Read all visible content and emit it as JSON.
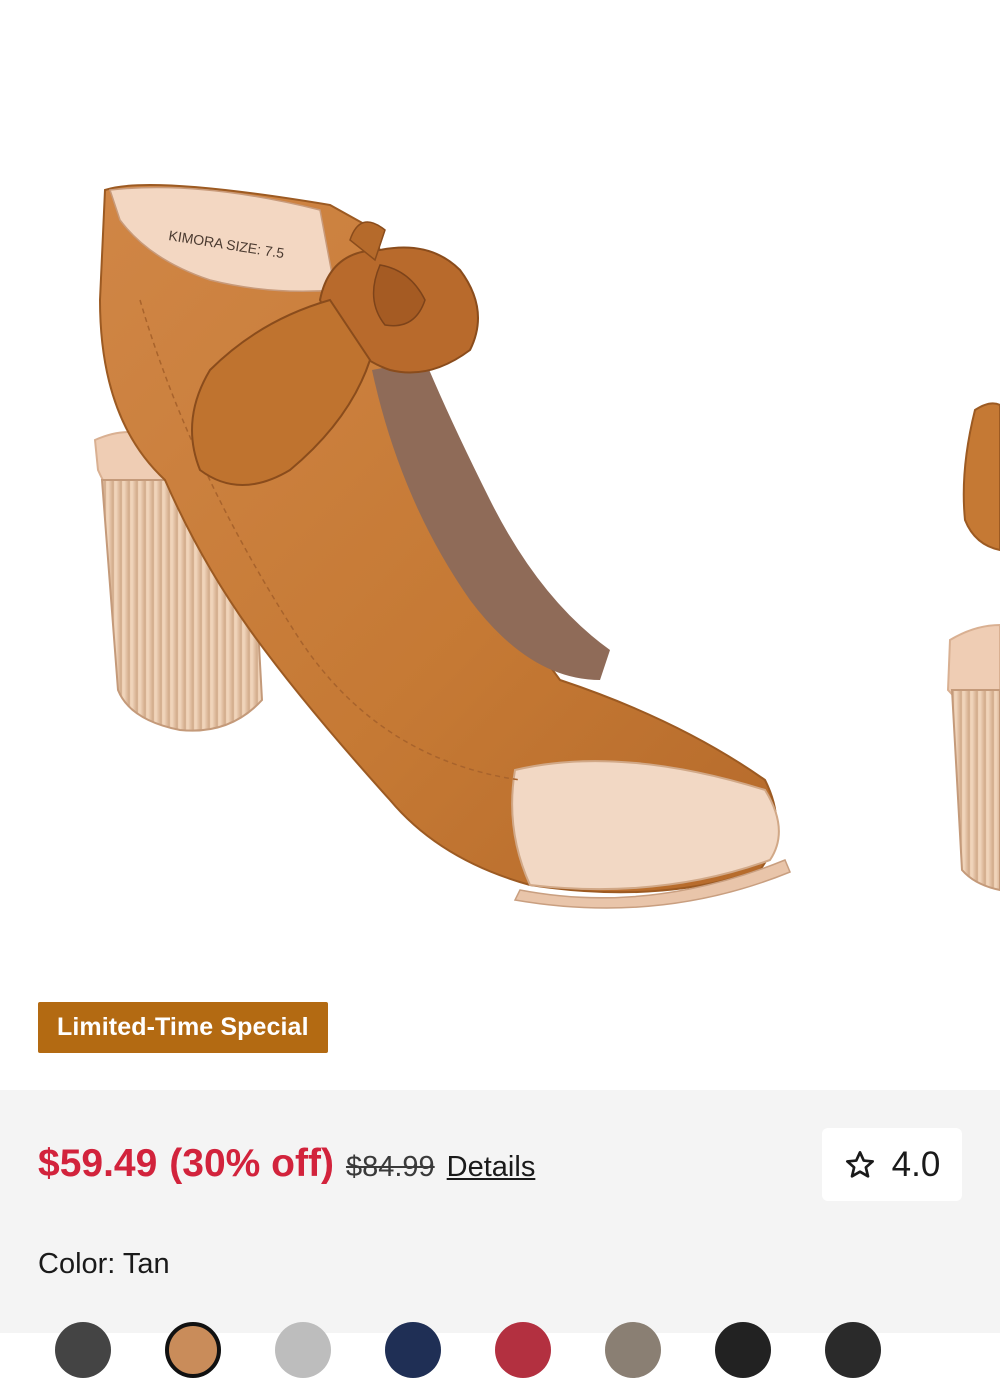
{
  "product": {
    "badge": "Limited-Time Special",
    "sale_price": "$59.49",
    "discount": "(30% off)",
    "original_price": "$84.99",
    "details_link": "Details",
    "rating": "4.0",
    "color_label": "Color:",
    "color_value": "Tan",
    "insole_label": "KIMORA  SIZE: 7.5"
  },
  "icons": {
    "rating": "star-outline-icon"
  },
  "colors": {
    "badge_bg": "#b36a12",
    "price_red": "#d2233c",
    "info_bg": "#f4f4f4",
    "shoe_tan": "#c97a3a"
  },
  "swatches": [
    {
      "name": "dark-gray",
      "color": "#444444",
      "selected": false
    },
    {
      "name": "tan",
      "color": "#c98c5a",
      "selected": true
    },
    {
      "name": "light-gray",
      "color": "#bdbdbd",
      "selected": false
    },
    {
      "name": "navy",
      "color": "#1f2f55",
      "selected": false
    },
    {
      "name": "red",
      "color": "#b33040",
      "selected": false
    },
    {
      "name": "taupe",
      "color": "#8a7f73",
      "selected": false
    },
    {
      "name": "black",
      "color": "#222222",
      "selected": false
    },
    {
      "name": "black-2",
      "color": "#2a2a2a",
      "selected": false
    }
  ]
}
